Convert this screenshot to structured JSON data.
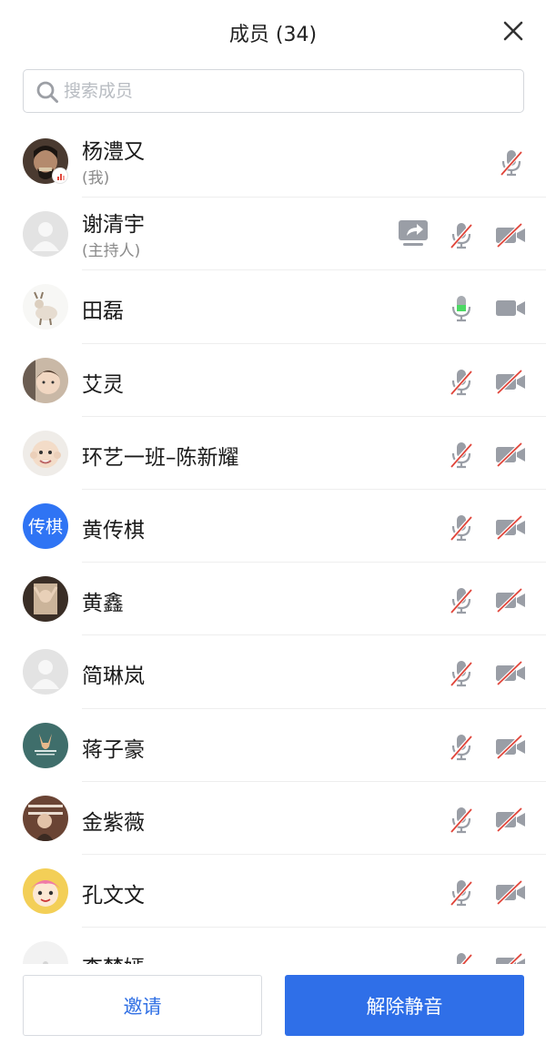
{
  "header": {
    "title": "成员 (34)"
  },
  "search": {
    "placeholder": "搜索成员"
  },
  "members": [
    {
      "name": "杨澧又",
      "sub": "(我)",
      "avatar": "photo-man",
      "mic": "off",
      "cam": "none",
      "share": false
    },
    {
      "name": "谢清宇",
      "sub": "(主持人)",
      "avatar": "default",
      "mic": "off",
      "cam": "off",
      "share": true
    },
    {
      "name": "田磊",
      "sub": "",
      "avatar": "photo-goat",
      "mic": "on",
      "cam": "on",
      "share": false
    },
    {
      "name": "艾灵",
      "sub": "",
      "avatar": "photo-child",
      "mic": "off",
      "cam": "off",
      "share": false
    },
    {
      "name": "环艺一班–陈新耀",
      "sub": "",
      "avatar": "photo-baby",
      "mic": "off",
      "cam": "off",
      "share": false
    },
    {
      "name": "黄传棋",
      "sub": "",
      "avatar": "text",
      "avatar_text": "传棋",
      "mic": "off",
      "cam": "off",
      "share": false
    },
    {
      "name": "黄鑫",
      "sub": "",
      "avatar": "photo-pose",
      "mic": "off",
      "cam": "off",
      "share": false
    },
    {
      "name": "简琳岚",
      "sub": "",
      "avatar": "default",
      "mic": "off",
      "cam": "off",
      "share": false
    },
    {
      "name": "蒋子豪",
      "sub": "",
      "avatar": "photo-fox",
      "mic": "off",
      "cam": "off",
      "share": false
    },
    {
      "name": "金紫薇",
      "sub": "",
      "avatar": "photo-girl",
      "mic": "off",
      "cam": "off",
      "share": false
    },
    {
      "name": "孔文文",
      "sub": "",
      "avatar": "photo-cartoon",
      "mic": "off",
      "cam": "off",
      "share": false
    },
    {
      "name": "李梦嫣",
      "sub": "",
      "avatar": "photo-white",
      "mic": "off",
      "cam": "off",
      "share": false
    }
  ],
  "footer": {
    "invite_label": "邀请",
    "unmute_label": "解除静音"
  },
  "colors": {
    "accent": "#2f6fe8",
    "mic_on": "#4cd964",
    "muted_slash": "#e0453a",
    "icon_gray": "#9a9ea6"
  },
  "icons": {
    "close": "close-icon",
    "search": "search-icon",
    "mic": "mic-icon",
    "camera": "camera-icon",
    "share": "screen-share-icon"
  }
}
